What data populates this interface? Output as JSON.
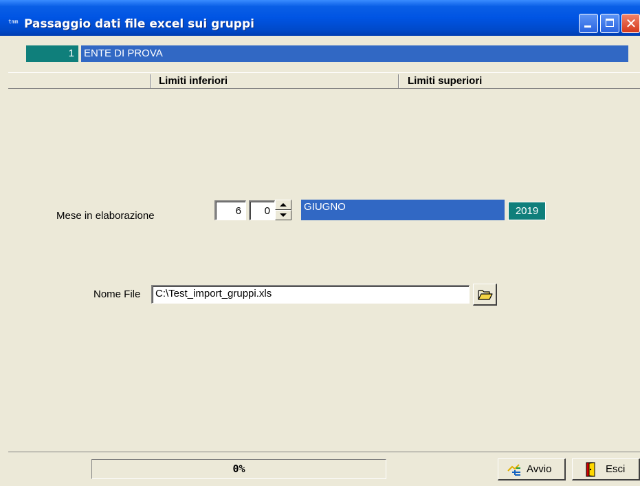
{
  "window": {
    "title": "Passaggio dati file excel sui gruppi",
    "app_icon_text": "tmm"
  },
  "ente": {
    "code": "1",
    "name": "ENTE DI PROVA"
  },
  "header": {
    "lower_limits": "Limiti inferiori",
    "upper_limits": "Limiti superiori"
  },
  "month": {
    "label": "Mese in elaborazione",
    "month_value": "6",
    "second_value": "0",
    "month_name": "GIUGNO",
    "year": "2019"
  },
  "file": {
    "label": "Nome File",
    "value": "C:\\Test_import_gruppi.xls"
  },
  "status": {
    "progress_text": "0%",
    "progress_percent": 0
  },
  "buttons": {
    "start": "Avvio",
    "exit": "Esci"
  },
  "icons": [
    "app-icon",
    "minimize-icon",
    "maximize-icon",
    "close-icon",
    "spin-up-icon",
    "spin-down-icon",
    "folder-open-icon",
    "run-icon",
    "exit-door-icon"
  ],
  "colors": {
    "titlebar": "#0054E3",
    "teal": "#0F7F7B",
    "blue_field": "#3168C4",
    "window_bg": "#ECE9D8"
  }
}
